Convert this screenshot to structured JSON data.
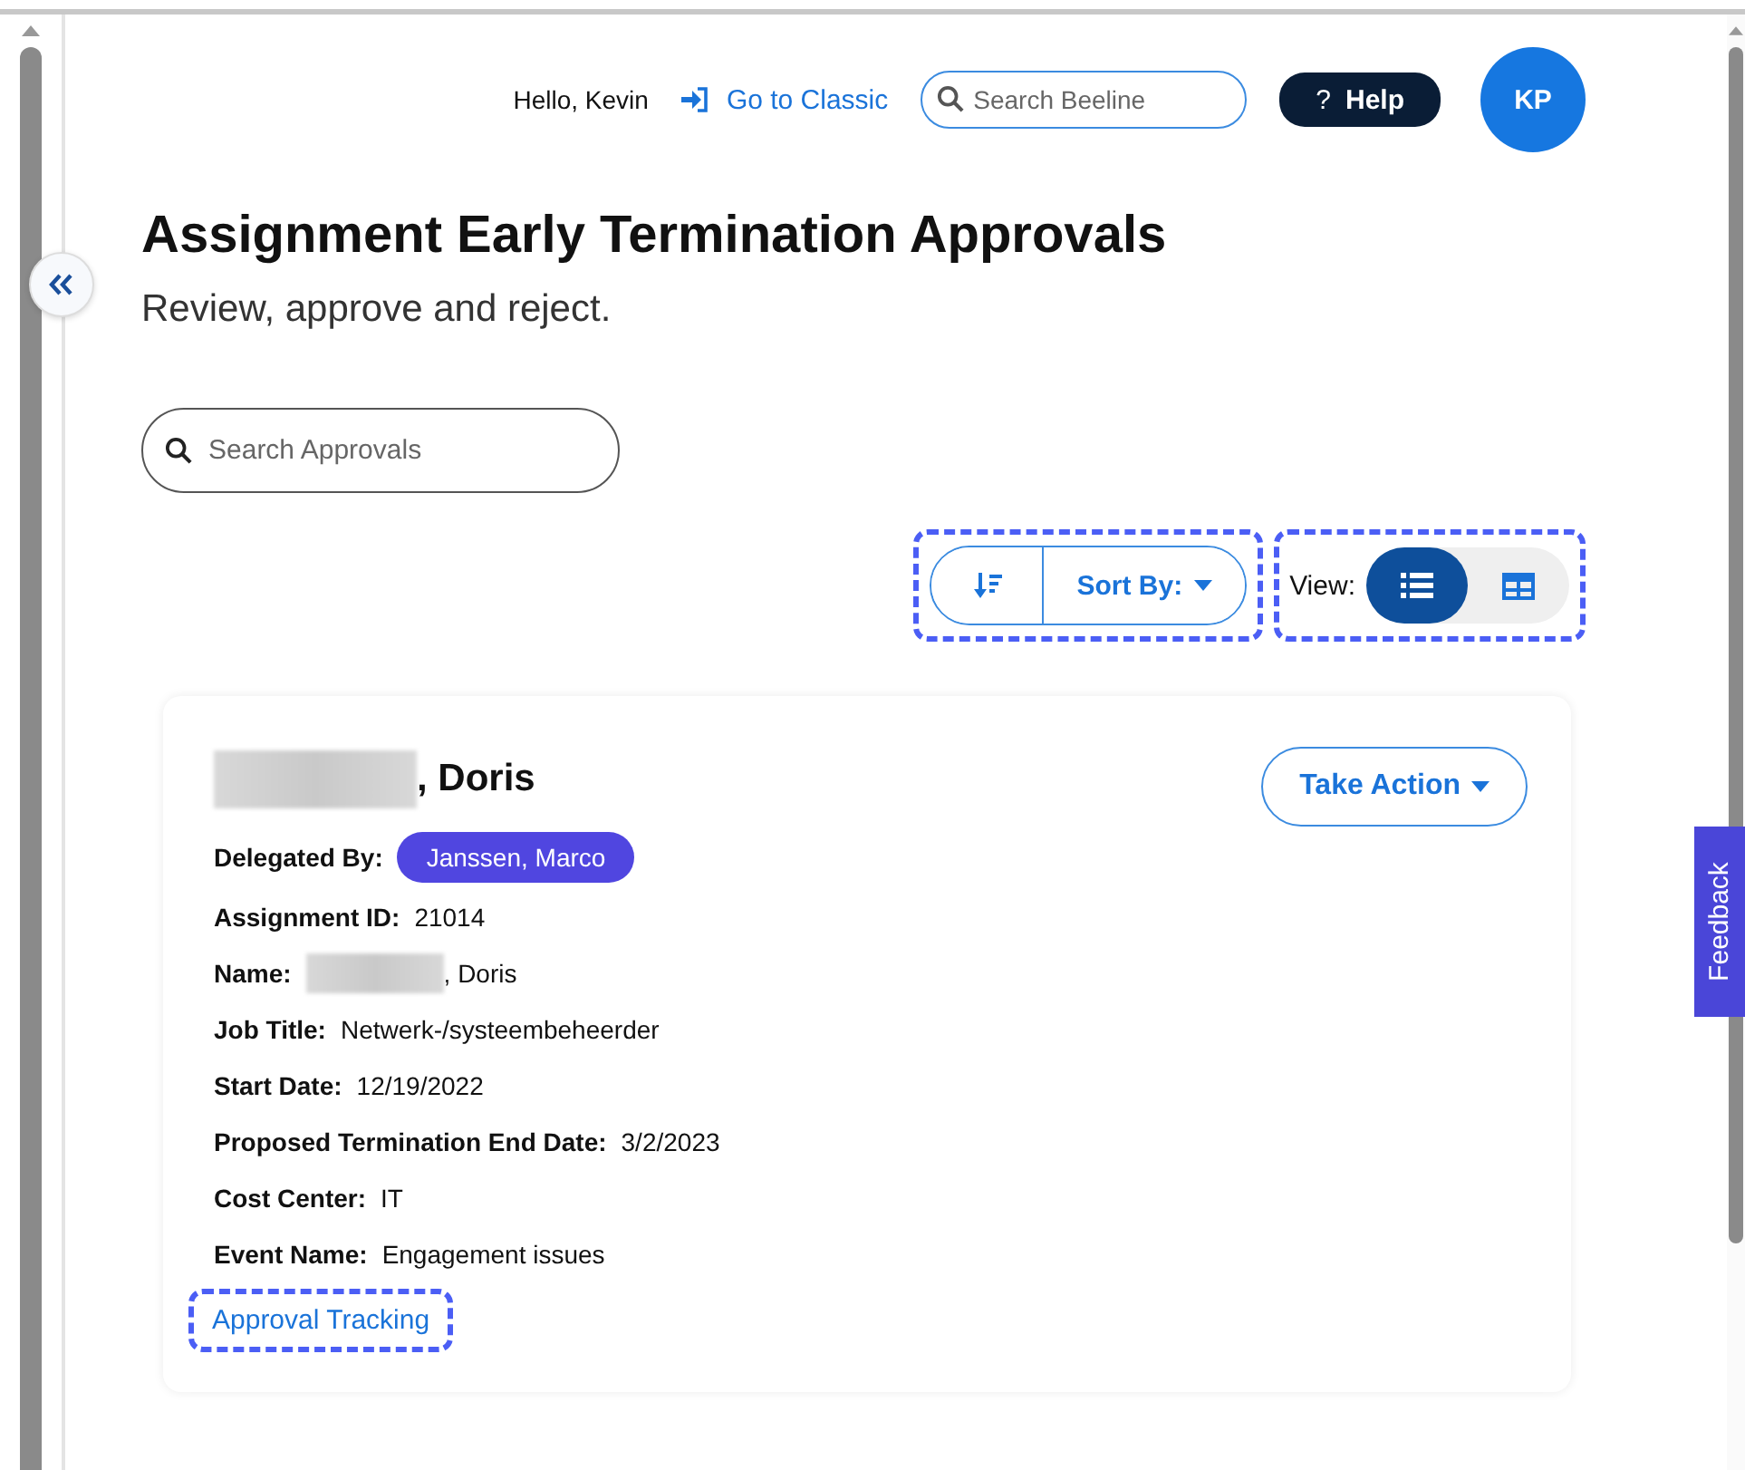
{
  "header": {
    "greeting": "Hello, Kevin",
    "classic_link": "Go to Classic",
    "search": {
      "placeholder": "Search Beeline"
    },
    "help_glyph": "?",
    "help": "Help",
    "avatar": "KP"
  },
  "page": {
    "title": "Assignment Early Termination Approvals",
    "subtitle": "Review, approve and reject."
  },
  "search": {
    "placeholder": "Search Approvals"
  },
  "sort": {
    "label": "Sort By:",
    "highlighted": true
  },
  "view": {
    "label": "View:",
    "highlighted": true,
    "options": [
      {
        "kind": "list",
        "selected": true
      },
      {
        "kind": "grid",
        "selected": false
      }
    ]
  },
  "card": {
    "name": {
      "text": ", Doris",
      "redacted": true
    },
    "action": "Take Action",
    "delegated": {
      "label": "Delegated By:",
      "value": "Janssen, Marco"
    },
    "fields": [
      {
        "label": "Assignment ID:",
        "value": "21014",
        "redacted": false
      },
      {
        "label": "Name:",
        "value": ", Doris",
        "redacted": true
      },
      {
        "label": "Job Title:",
        "value": "Netwerk-/systeembeheerder",
        "redacted": false
      },
      {
        "label": "Start Date:",
        "value": "12/19/2022",
        "redacted": false
      },
      {
        "label": "Proposed Termination End Date:",
        "value": "3/2/2023",
        "redacted": false
      },
      {
        "label": "Cost Center:",
        "value": "IT",
        "redacted": false
      },
      {
        "label": "Event Name:",
        "value": "Engagement issues",
        "redacted": false
      }
    ],
    "link": {
      "text": "Approval Tracking",
      "highlighted": true
    }
  },
  "feedback": "Feedback"
}
